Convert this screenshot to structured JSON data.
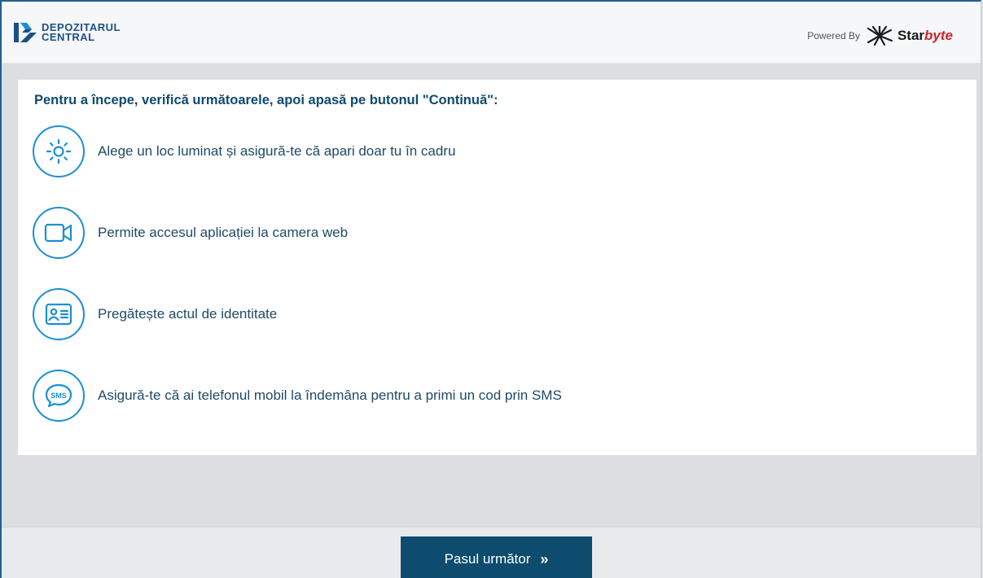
{
  "header": {
    "logo_line1": "DEPOZITARUL",
    "logo_line2": "CENTRAL",
    "powered_label": "Powered By",
    "brand_star": "Star",
    "brand_byte": "byte"
  },
  "main": {
    "heading": "Pentru a începe, verifică următoarele, apoi apasă pe butonul \"Continuă\":",
    "items": [
      {
        "icon": "sun-icon",
        "text": "Alege un loc luminat și asigură-te că apari doar tu în cadru"
      },
      {
        "icon": "video-camera-icon",
        "text": "Permite accesul aplicației la camera web"
      },
      {
        "icon": "id-card-icon",
        "text": "Pregătește actul de identitate"
      },
      {
        "icon": "sms-icon",
        "text": "Asigură-te că ai telefonul mobil la îndemâna pentru a primi un cod prin SMS"
      }
    ]
  },
  "footer": {
    "next_label": "Pasul următor",
    "next_icon": "double-chevron-right-icon"
  },
  "colors": {
    "brand_blue": "#1b4f86",
    "icon_blue": "#1c8fd4",
    "heading_text": "#0f4a6e",
    "button_bg": "#0d4c6e",
    "starbyte_red": "#c9252c"
  }
}
